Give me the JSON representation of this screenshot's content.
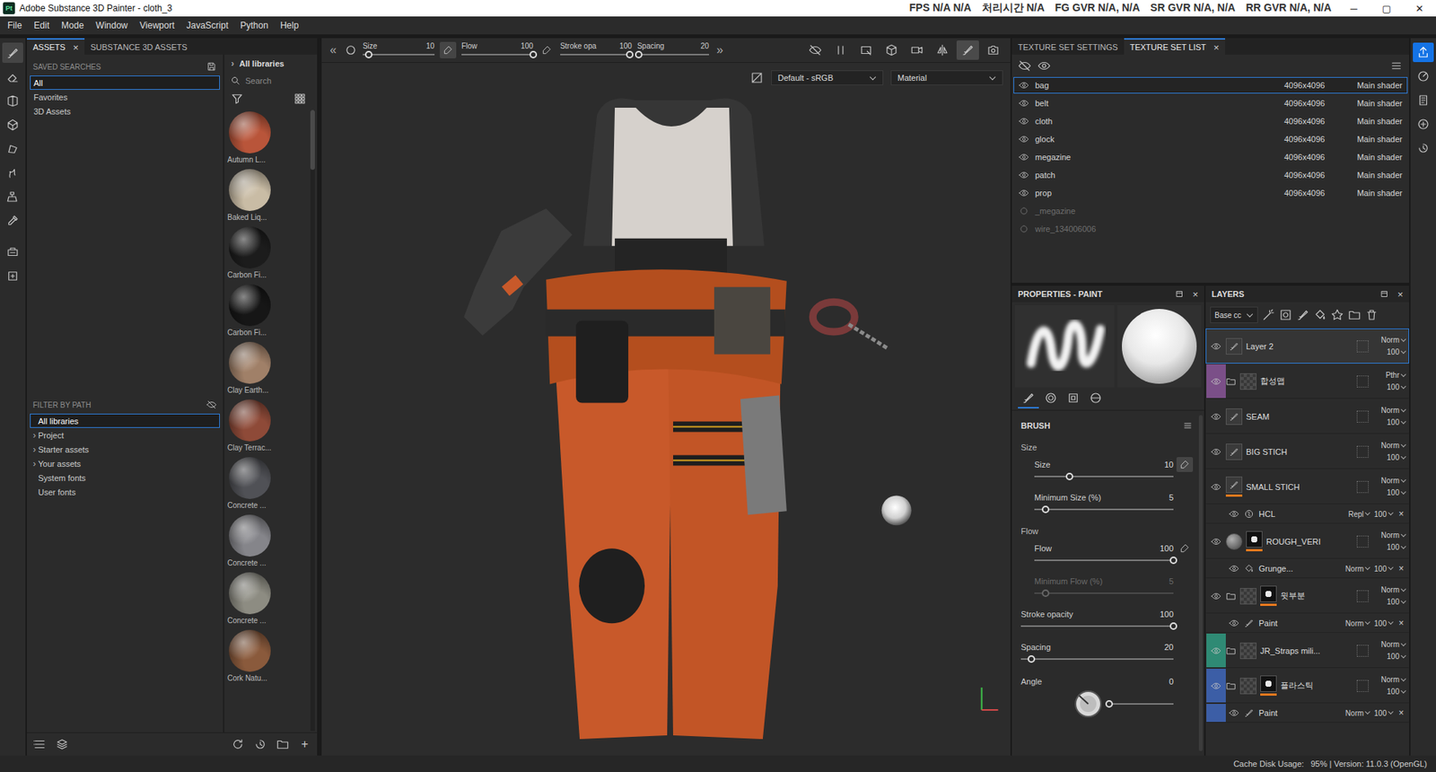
{
  "window": {
    "logo": "Pt",
    "title": "Adobe Substance 3D Painter - cloth_3",
    "controls": [
      "─",
      "▢",
      "✕"
    ]
  },
  "overlay": [
    "FPS N/A N/A",
    "처리시간 N/A",
    "FG GVR N/A, N/A",
    "SR GVR N/A, N/A",
    "RR GVR N/A, N/A"
  ],
  "menu": [
    "File",
    "Edit",
    "Mode",
    "Window",
    "Viewport",
    "JavaScript",
    "Python",
    "Help"
  ],
  "close": "×",
  "tools": [
    {
      "kind": "paint",
      "selected": true
    },
    {
      "kind": "eraser",
      "selected": false
    },
    {
      "kind": "projection",
      "selected": false
    },
    {
      "kind": "geometry",
      "selected": false
    },
    {
      "kind": "polygon",
      "selected": false
    },
    {
      "kind": "smudge",
      "selected": false
    },
    {
      "kind": "clone",
      "selected": false
    },
    {
      "kind": "picker",
      "selected": false
    },
    {
      "kind": "bake",
      "selected": false
    },
    {
      "kind": "export",
      "selected": false
    }
  ],
  "assets": {
    "tabs": [
      {
        "label": "ASSETS",
        "selected": true,
        "closable": true
      },
      {
        "label": "SUBSTANCE 3D ASSETS",
        "selected": false,
        "closable": false
      }
    ],
    "saved_searches": {
      "title": "SAVED SEARCHES",
      "items": [
        {
          "label": "All",
          "selected": true
        },
        {
          "label": "Favorites",
          "selected": false
        },
        {
          "label": "3D Assets",
          "selected": false
        }
      ]
    },
    "filter": {
      "title": "FILTER BY PATH",
      "items": [
        {
          "label": "All libraries",
          "selected": true,
          "expandable": false
        },
        {
          "label": "Project",
          "selected": false,
          "expandable": true
        },
        {
          "label": "Starter assets",
          "selected": false,
          "expandable": true
        },
        {
          "label": "Your assets",
          "selected": false,
          "expandable": true
        },
        {
          "label": "System fonts",
          "selected": false,
          "expandable": false
        },
        {
          "label": "User fonts",
          "selected": false,
          "expandable": false
        }
      ]
    },
    "expand": "›",
    "library": {
      "title": "All libraries",
      "search": "Search",
      "materials": [
        {
          "label": "Autumn L...",
          "color": "#b9553a"
        },
        {
          "label": "Baked Liq...",
          "color": "#c9bca5"
        },
        {
          "label": "Carbon Fi...",
          "color": "#1c1c1c"
        },
        {
          "label": "Carbon Fi...",
          "color": "#161616"
        },
        {
          "label": "Clay Earth...",
          "color": "#a08068"
        },
        {
          "label": "Clay Terrac...",
          "color": "#8e4a38"
        },
        {
          "label": "Concrete ...",
          "color": "#505156"
        },
        {
          "label": "Concrete ...",
          "color": "#85858a"
        },
        {
          "label": "Concrete ...",
          "color": "#8d8c82"
        },
        {
          "label": "Cork Natu...",
          "color": "#8a5a3c"
        }
      ]
    },
    "add": "+"
  },
  "viewport": {
    "collapse": "«",
    "expand": "»",
    "sliders": [
      {
        "label": "Size",
        "value": "10",
        "level": 0.08,
        "pressure": "on"
      },
      {
        "label": "Flow",
        "value": "100",
        "level": 1,
        "pressure": "off"
      },
      {
        "label": "Stroke opa",
        "value": "100",
        "level": 0.97,
        "pressure": "none"
      },
      {
        "label": "Spacing",
        "value": "20",
        "level": 0.02,
        "pressure": "none"
      }
    ],
    "tools": [
      {
        "kind": "hide",
        "selected": false
      },
      {
        "kind": "pause",
        "selected": false
      },
      {
        "kind": "select",
        "selected": false
      },
      {
        "kind": "cube",
        "selected": false
      },
      {
        "kind": "camera",
        "selected": false
      },
      {
        "kind": "symmetry",
        "selected": false
      },
      {
        "kind": "paint",
        "selected": true
      },
      {
        "kind": "screenshot",
        "selected": false
      }
    ],
    "colorspace": "Default - sRGB",
    "channel": "Material"
  },
  "texture_sets": {
    "tabs": [
      {
        "label": "TEXTURE SET SETTINGS",
        "selected": false,
        "closable": false
      },
      {
        "label": "TEXTURE SET LIST",
        "selected": true,
        "closable": true
      }
    ],
    "rows": [
      {
        "name": "bag",
        "resolution": "4096x4096",
        "shader": "Main shader",
        "visible": true,
        "selected": true
      },
      {
        "name": "belt",
        "resolution": "4096x4096",
        "shader": "Main shader",
        "visible": true,
        "selected": false
      },
      {
        "name": "cloth",
        "resolution": "4096x4096",
        "shader": "Main shader",
        "visible": true,
        "selected": false
      },
      {
        "name": "glock",
        "resolution": "4096x4096",
        "shader": "Main shader",
        "visible": true,
        "selected": false
      },
      {
        "name": "megazine",
        "resolution": "4096x4096",
        "shader": "Main shader",
        "visible": true,
        "selected": false
      },
      {
        "name": "patch",
        "resolution": "4096x4096",
        "shader": "Main shader",
        "visible": true,
        "selected": false
      },
      {
        "name": "prop",
        "resolution": "4096x4096",
        "shader": "Main shader",
        "visible": true,
        "selected": false
      },
      {
        "name": "_megazine",
        "resolution": "",
        "shader": "",
        "visible": false,
        "selected": false
      },
      {
        "name": "wire_134006006",
        "resolution": "",
        "shader": "",
        "visible": false,
        "selected": false
      }
    ]
  },
  "properties": {
    "title": "PROPERTIES - PAINT",
    "tabs": [
      {
        "kind": "brush",
        "selected": true
      },
      {
        "kind": "alpha",
        "selected": false
      },
      {
        "kind": "stencil",
        "selected": false
      },
      {
        "kind": "material",
        "selected": false
      }
    ],
    "section": "BRUSH",
    "params": [
      {
        "kind": "heading",
        "label": "Size"
      },
      {
        "kind": "sub-slider",
        "label": "Size",
        "value": "10",
        "level": 0.25,
        "disabled": false,
        "pressure": "on"
      },
      {
        "kind": "sub-slider",
        "label": "Minimum Size (%)",
        "value": "5",
        "level": 0.08,
        "disabled": false,
        "pressure": "none"
      },
      {
        "kind": "heading",
        "label": "Flow"
      },
      {
        "kind": "sub-slider",
        "label": "Flow",
        "value": "100",
        "level": 1,
        "disabled": false,
        "pressure": "off"
      },
      {
        "kind": "sub-slider",
        "label": "Minimum Flow (%)",
        "value": "5",
        "level": 0.08,
        "disabled": true,
        "pressure": "none"
      },
      {
        "kind": "slider",
        "label": "Stroke opacity",
        "value": "100",
        "level": 1,
        "disabled": false,
        "pressure": "none"
      },
      {
        "kind": "slider",
        "label": "Spacing",
        "value": "20",
        "level": 0.07,
        "disabled": false,
        "pressure": "none"
      },
      {
        "kind": "angle",
        "label": "Angle",
        "value": "0",
        "level": 0,
        "disabled": false,
        "pressure": "none"
      }
    ]
  },
  "layers": {
    "title": "LAYERS",
    "channel": "Base cc",
    "rows": [
      {
        "kind": "layer",
        "type": "paint",
        "name": "Layer 2",
        "blend": "Norm",
        "opacity": "100",
        "visible": true,
        "selected": true,
        "mask": false,
        "marker": false
      },
      {
        "kind": "layer",
        "type": "folder",
        "name": "합성맵",
        "blend": "Pthr",
        "opacity": "100",
        "visible": true,
        "selected": false,
        "mask": false,
        "marker": false,
        "color": "#7b4f88"
      },
      {
        "kind": "layer",
        "type": "paint",
        "name": "SEAM",
        "blend": "Norm",
        "opacity": "100",
        "visible": true,
        "selected": false,
        "mask": false,
        "marker": false
      },
      {
        "kind": "layer",
        "type": "paint",
        "name": "BIG STICH",
        "blend": "Norm",
        "opacity": "100",
        "visible": true,
        "selected": false,
        "mask": false,
        "marker": false
      },
      {
        "kind": "layer",
        "type": "paint",
        "name": "SMALL STICH",
        "blend": "Norm",
        "opacity": "100",
        "visible": true,
        "selected": false,
        "mask": false,
        "marker": true
      },
      {
        "kind": "effect",
        "type": "filter",
        "name": "HCL",
        "blend": "Repl",
        "opacity": "100",
        "visible": true,
        "selected": false
      },
      {
        "kind": "layer",
        "type": "fill",
        "name": "ROUGH_VERI",
        "blend": "Norm",
        "opacity": "100",
        "visible": true,
        "selected": false,
        "mask": true,
        "marker": true
      },
      {
        "kind": "effect",
        "type": "fill",
        "name": "Grunge...",
        "blend": "Norm",
        "opacity": "100",
        "visible": true,
        "selected": false
      },
      {
        "kind": "layer",
        "type": "folder",
        "name": "윗부분",
        "blend": "Norm",
        "opacity": "100",
        "visible": true,
        "selected": false,
        "mask": true,
        "marker": true
      },
      {
        "kind": "effect",
        "type": "paint",
        "name": "Paint",
        "blend": "Norm",
        "opacity": "100",
        "visible": true,
        "selected": false
      },
      {
        "kind": "layer",
        "type": "folder",
        "name": "JR_Straps mili...",
        "blend": "Norm",
        "opacity": "100",
        "visible": true,
        "selected": false,
        "mask": false,
        "marker": false,
        "color": "#2f8a74"
      },
      {
        "kind": "layer",
        "type": "folder",
        "name": "플라스틱",
        "blend": "Norm",
        "opacity": "100",
        "visible": true,
        "selected": false,
        "mask": true,
        "marker": true,
        "color": "#3c5ea6"
      },
      {
        "kind": "effect",
        "type": "paint",
        "name": "Paint",
        "blend": "Norm",
        "opacity": "100",
        "visible": true,
        "selected": false,
        "color": "#3c5ea6"
      }
    ]
  },
  "side_tools": [
    {
      "kind": "share",
      "selected": true
    },
    {
      "kind": "display",
      "selected": false
    },
    {
      "kind": "notes",
      "selected": false
    },
    {
      "kind": "shader",
      "selected": false
    },
    {
      "kind": "history",
      "selected": false
    }
  ],
  "status": "Cache Disk Usage:   95% | Version: 11.0.3 (OpenGL)"
}
